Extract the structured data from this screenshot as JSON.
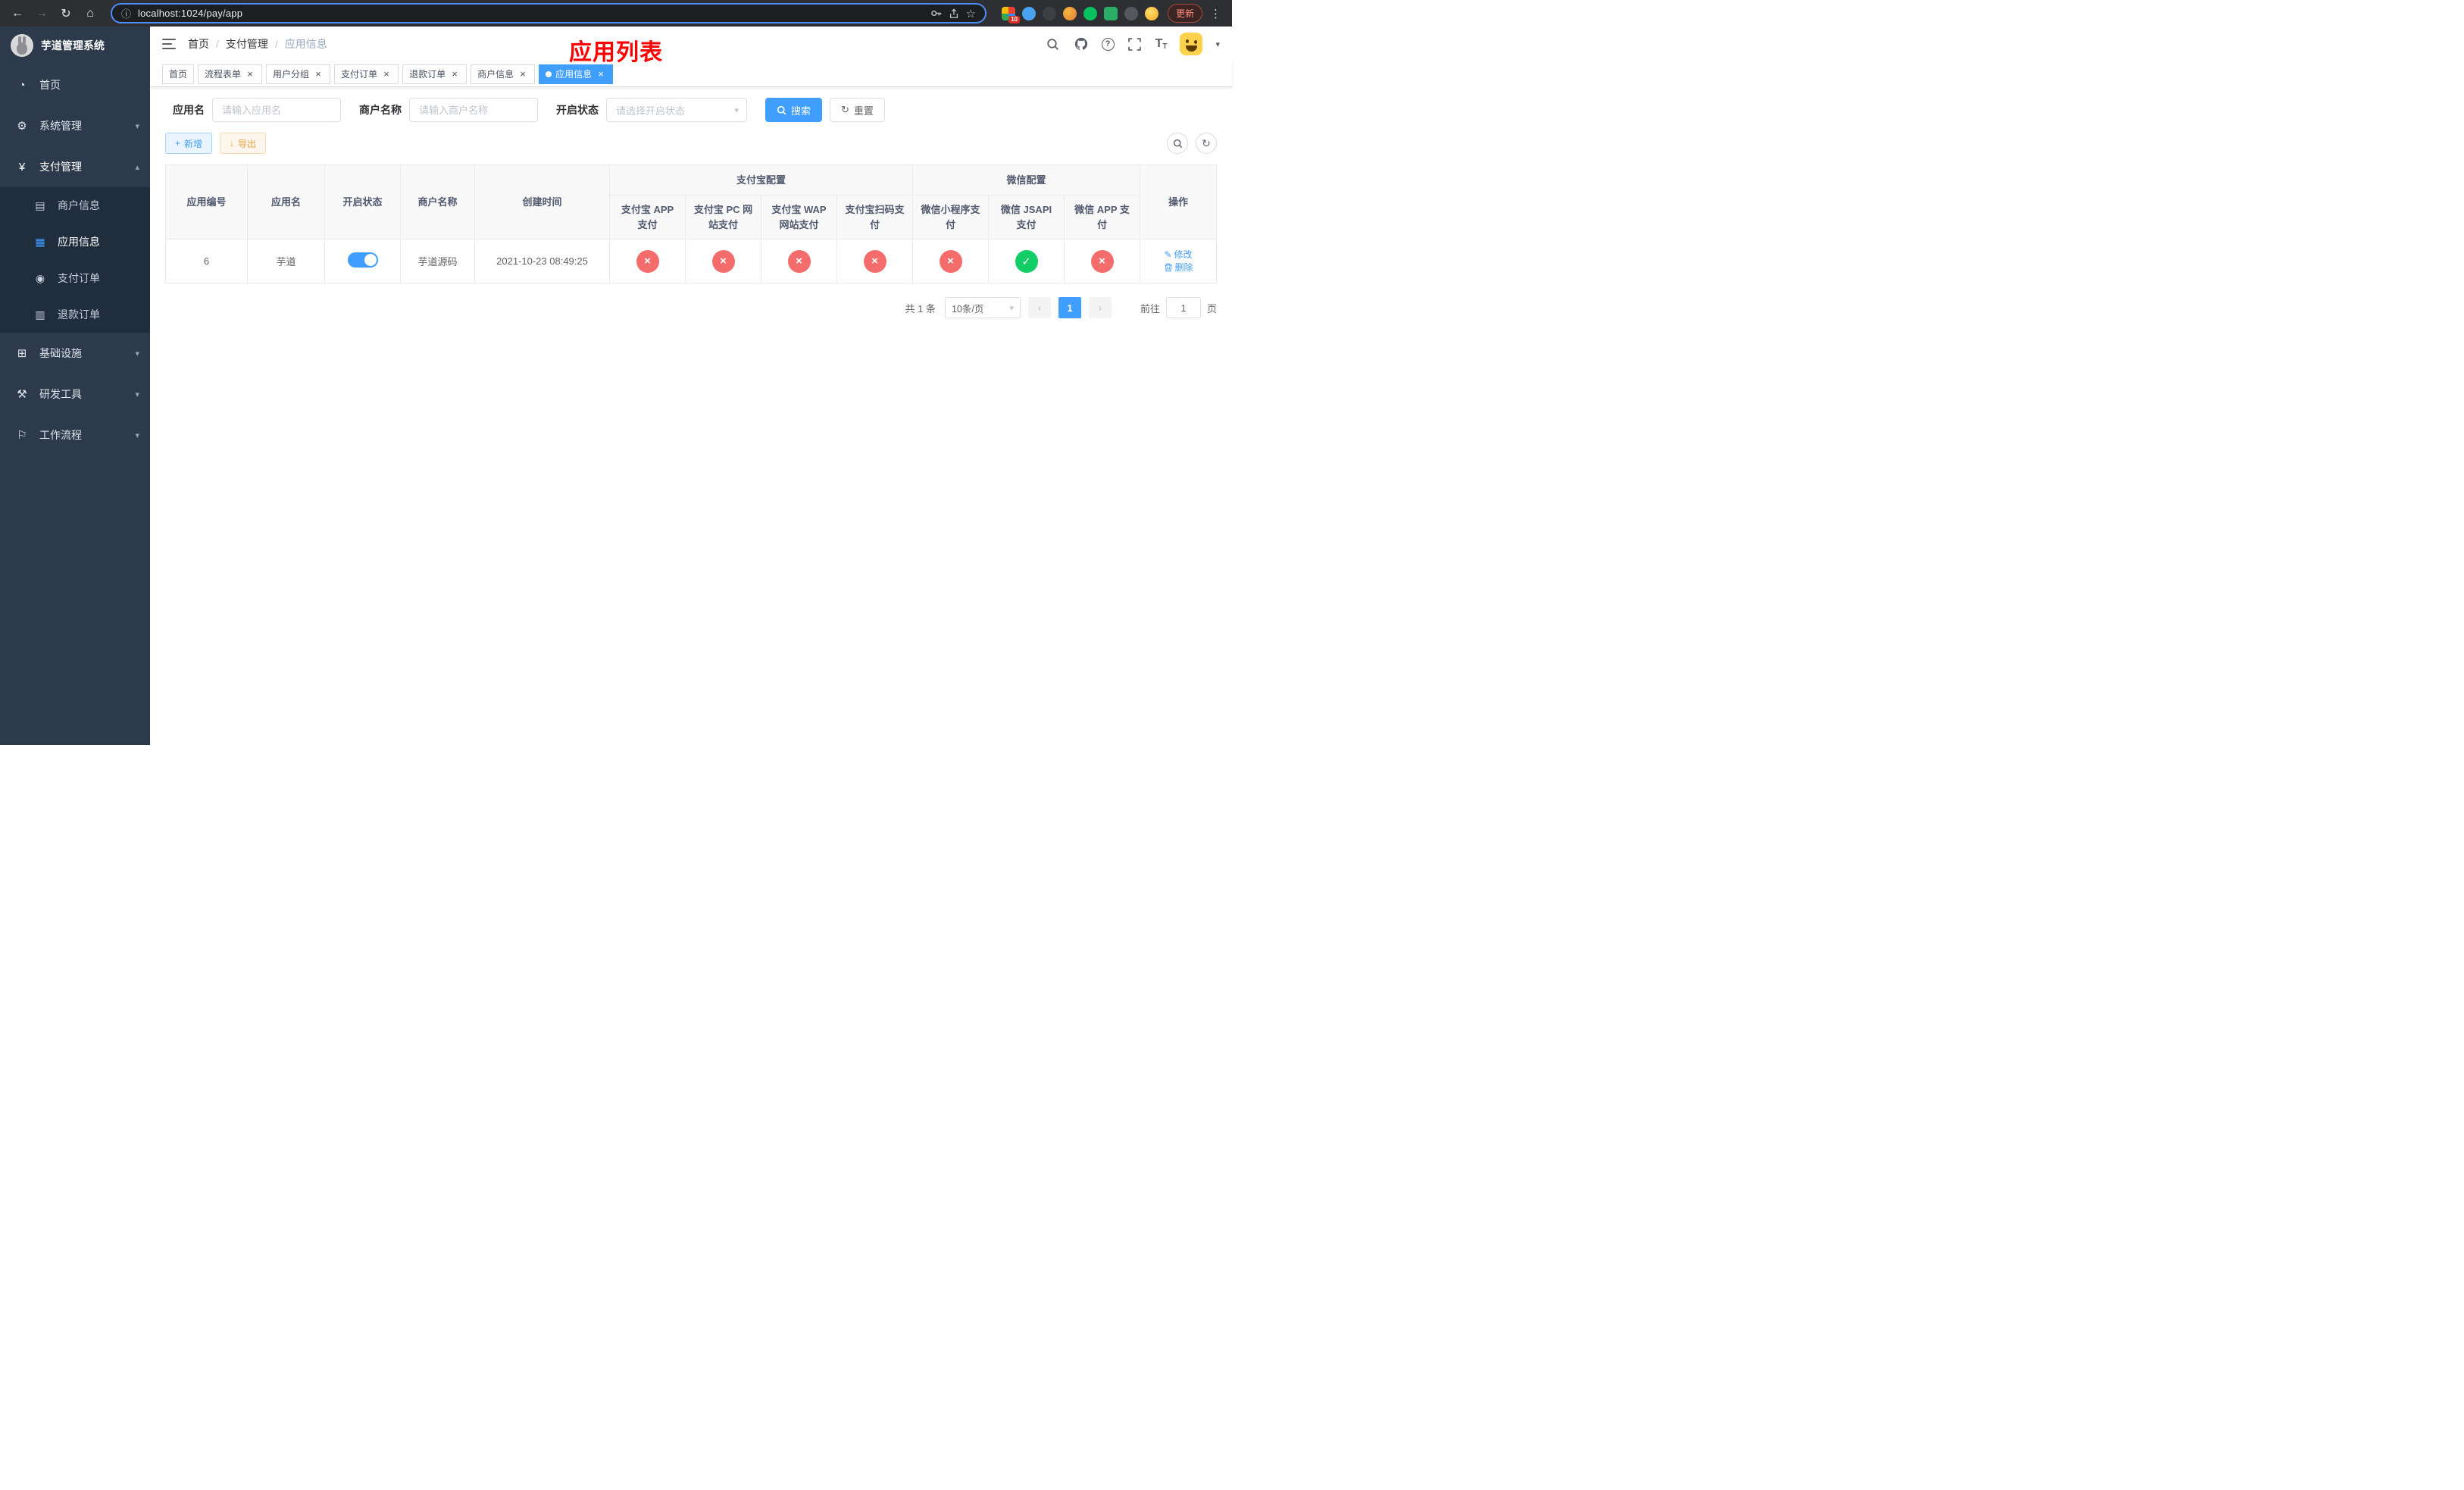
{
  "browser": {
    "url": "localhost:1024/pay/app",
    "update_label": "更新",
    "extension_badge": "10"
  },
  "icons": {
    "back": "←",
    "forward": "→",
    "reload": "↻",
    "home": "⌂",
    "info": "ⓘ",
    "star": "☆",
    "dots": "⋮",
    "dashboard": "◔",
    "gear": "⚙",
    "yen": "¥",
    "card": "▤",
    "grid": "▦",
    "order": "◉",
    "refund": "▥",
    "infra": "⊞",
    "tools": "⚒",
    "flag": "⚐",
    "chev_down": "▾",
    "chev_up": "▴",
    "caret": "▾",
    "close": "×",
    "cross": "×",
    "check": "✓",
    "plus": "+",
    "download": "↓",
    "refresh": "↻",
    "question": "?",
    "fontsize": "T",
    "edit": "✎",
    "prev": "‹",
    "next": "›"
  },
  "sidebar": {
    "title": "芋道管理系统",
    "items": [
      {
        "label": "首页"
      },
      {
        "label": "系统管理"
      },
      {
        "label": "支付管理",
        "expanded": true,
        "children": [
          {
            "label": "商户信息"
          },
          {
            "label": "应用信息",
            "active": true
          },
          {
            "label": "支付订单"
          },
          {
            "label": "退款订单"
          }
        ]
      },
      {
        "label": "基础设施"
      },
      {
        "label": "研发工具"
      },
      {
        "label": "工作流程"
      }
    ]
  },
  "header": {
    "breadcrumb": [
      "首页",
      "支付管理",
      "应用信息"
    ],
    "separator": "/",
    "overlay_title": "应用列表"
  },
  "tabs": [
    {
      "label": "首页",
      "closable": false
    },
    {
      "label": "流程表单",
      "closable": true
    },
    {
      "label": "用户分组",
      "closable": true
    },
    {
      "label": "支付订单",
      "closable": true
    },
    {
      "label": "退款订单",
      "closable": true
    },
    {
      "label": "商户信息",
      "closable": true
    },
    {
      "label": "应用信息",
      "closable": true,
      "active": true
    }
  ],
  "filters": {
    "app_name_label": "应用名",
    "app_name_placeholder": "请输入应用名",
    "merchant_label": "商户名称",
    "merchant_placeholder": "请输入商户名称",
    "status_label": "开启状态",
    "status_placeholder": "请选择开启状态",
    "search_label": "搜索",
    "reset_label": "重置"
  },
  "toolbar": {
    "add_label": "新增",
    "export_label": "导出"
  },
  "table": {
    "main_headers": [
      "应用编号",
      "应用名",
      "开启状态",
      "商户名称",
      "创建时间"
    ],
    "group_headers": [
      "支付宝配置",
      "微信配置"
    ],
    "sub_headers": [
      "支付宝 APP 支付",
      "支付宝 PC 网站支付",
      "支付宝 WAP 网站支付",
      "支付宝扫码支付",
      "微信小程序支付",
      "微信 JSAPI 支付",
      "微信 APP 支付"
    ],
    "action_header": "操作",
    "rows": [
      {
        "id": "6",
        "name": "芋道",
        "enabled": "yes",
        "merchant": "芋道源码",
        "created": "2021-10-23 08:49:25",
        "configs": [
          "no",
          "no",
          "no",
          "no",
          "no",
          "yes",
          "no"
        ],
        "actions": [
          "修改",
          "删除"
        ]
      }
    ]
  },
  "pagination": {
    "total": "共 1 条",
    "page_size": "10条/页",
    "current_page": "1",
    "goto_label": "前往",
    "goto_value": "1",
    "unit": "页"
  },
  "colors": {
    "primary": "#409eff",
    "danger": "#f56c6c",
    "success": "#13ce66",
    "title_red": "#ff0000"
  }
}
